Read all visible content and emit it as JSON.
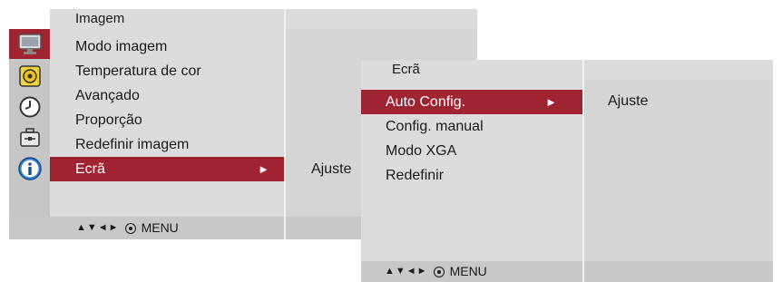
{
  "main": {
    "header_title": "Imagem",
    "items": [
      {
        "label": "Modo imagem"
      },
      {
        "label": "Temperatura de cor"
      },
      {
        "label": "Avançado"
      },
      {
        "label": "Proporção"
      },
      {
        "label": "Redefinir imagem"
      },
      {
        "label": "Ecrã",
        "selected": true
      }
    ],
    "submenu_arrow": "►",
    "right_value": "Ajuste",
    "icons": [
      "monitor-icon",
      "speaker-icon",
      "clock-icon",
      "toolbox-icon",
      "info-icon"
    ],
    "active_icon": "monitor-icon",
    "footer": {
      "arrows": "▲▼◄►",
      "menu_label": "MENU"
    }
  },
  "sub": {
    "header_title": "Ecrã",
    "items": [
      {
        "label": "Auto Config.",
        "selected": true
      },
      {
        "label": "Config. manual"
      },
      {
        "label": "Modo XGA"
      },
      {
        "label": "Redefinir"
      }
    ],
    "submenu_arrow": "►",
    "right_value": "Ajuste",
    "footer": {
      "arrows": "▲▼◄►",
      "menu_label": "MENU"
    }
  },
  "colors": {
    "selected": "#a02331",
    "panel_bg": "#dcdcdc",
    "icon_column": "#c6c6c6"
  }
}
